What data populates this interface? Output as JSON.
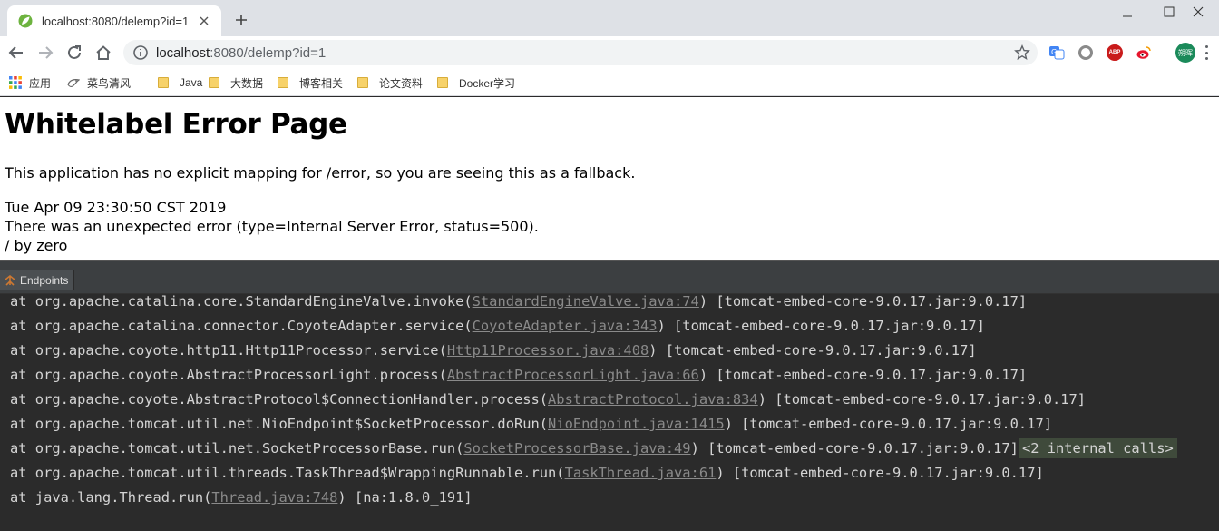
{
  "browser": {
    "tab_title": "localhost:8080/delemp?id=1",
    "url_host": "localhost",
    "url_rest": ":8080/delemp?id=1",
    "avatar_text": "朔晖"
  },
  "bookmarks": [
    {
      "label": "应用",
      "icon": "apps-grid-icon"
    },
    {
      "label": "菜鸟清风",
      "icon": "bird-icon"
    },
    {
      "label": "Java",
      "icon": "folder-icon"
    },
    {
      "label": "大数据",
      "icon": "folder-icon"
    },
    {
      "label": "博客相关",
      "icon": "folder-icon"
    },
    {
      "label": "论文资料",
      "icon": "folder-icon"
    },
    {
      "label": "Docker学习",
      "icon": "folder-icon"
    }
  ],
  "page": {
    "heading": "Whitelabel Error Page",
    "message": "This application has no explicit mapping for /error, so you are seeing this as a fallback.",
    "timestamp": "Tue Apr 09 23:30:50 CST 2019",
    "error_line": "There was an unexpected error (type=Internal Server Error, status=500).",
    "detail": "/ by zero"
  },
  "ide": {
    "tool_tab": "Endpoints",
    "lines": [
      {
        "pre": "at org.apache.catalina.core.StandardEngineValve.invoke(",
        "link": "StandardEngineValve.java:74",
        "post": ") [tomcat-embed-core-9.0.17.jar:9.0.17]"
      },
      {
        "pre": "at org.apache.catalina.connector.CoyoteAdapter.service(",
        "link": "CoyoteAdapter.java:343",
        "post": ") [tomcat-embed-core-9.0.17.jar:9.0.17]"
      },
      {
        "pre": "at org.apache.coyote.http11.Http11Processor.service(",
        "link": "Http11Processor.java:408",
        "post": ") [tomcat-embed-core-9.0.17.jar:9.0.17]"
      },
      {
        "pre": "at org.apache.coyote.AbstractProcessorLight.process(",
        "link": "AbstractProcessorLight.java:66",
        "post": ") [tomcat-embed-core-9.0.17.jar:9.0.17]"
      },
      {
        "pre": "at org.apache.coyote.AbstractProtocol$ConnectionHandler.process(",
        "link": "AbstractProtocol.java:834",
        "post": ") [tomcat-embed-core-9.0.17.jar:9.0.17]"
      },
      {
        "pre": "at org.apache.tomcat.util.net.NioEndpoint$SocketProcessor.doRun(",
        "link": "NioEndpoint.java:1415",
        "post": ") [tomcat-embed-core-9.0.17.jar:9.0.17]"
      },
      {
        "pre": "at org.apache.tomcat.util.net.SocketProcessorBase.run(",
        "link": "SocketProcessorBase.java:49",
        "post": ") [tomcat-embed-core-9.0.17.jar:9.0.17]",
        "chip": "<2 internal calls>"
      },
      {
        "pre": "at org.apache.tomcat.util.threads.TaskThread$WrappingRunnable.run(",
        "link": "TaskThread.java:61",
        "post": ") [tomcat-embed-core-9.0.17.jar:9.0.17]"
      },
      {
        "pre": "at java.lang.Thread.run(",
        "link": "Thread.java:748",
        "post": ") [na:1.8.0_191]"
      }
    ]
  }
}
